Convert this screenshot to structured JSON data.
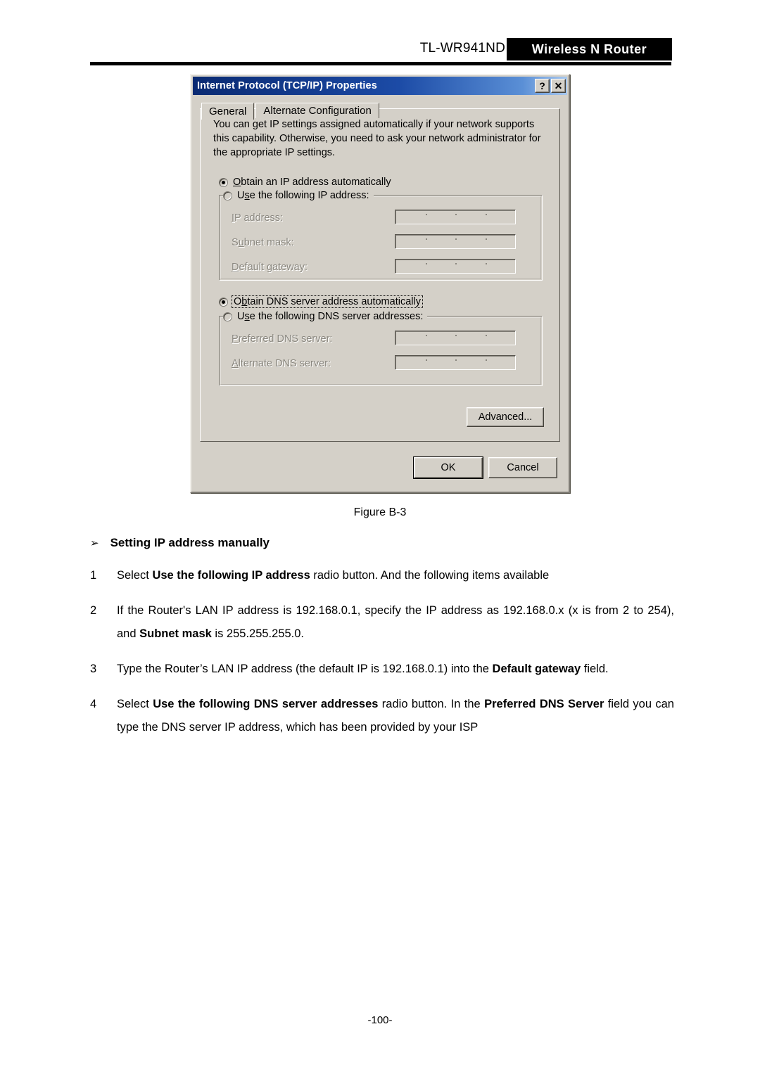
{
  "header": {
    "model": "TL-WR941ND",
    "banner": "Wireless N Router"
  },
  "dialog": {
    "title": "Internet Protocol (TCP/IP) Properties",
    "help_button": "?",
    "close_button": "✕",
    "tabs": [
      {
        "label": "General",
        "active": true
      },
      {
        "label": "Alternate Configuration",
        "active": false
      }
    ],
    "intro": "You can get IP settings assigned automatically if your network supports this capability. Otherwise, you need to ask your network administrator for the appropriate IP settings.",
    "ip_section": {
      "auto_radio": {
        "label": "Obtain an IP address automatically",
        "checked": true
      },
      "manual_radio": {
        "label": "Use the following IP address:",
        "checked": false
      },
      "fields": [
        {
          "label": "IP address:",
          "value": ""
        },
        {
          "label": "Subnet mask:",
          "value": ""
        },
        {
          "label": "Default gateway:",
          "value": ""
        }
      ]
    },
    "dns_section": {
      "auto_radio": {
        "label": "Obtain DNS server address automatically",
        "checked": true,
        "focused": true
      },
      "manual_radio": {
        "label": "Use the following DNS server addresses:",
        "checked": false
      },
      "fields": [
        {
          "label": "Preferred DNS server:",
          "value": ""
        },
        {
          "label": "Alternate DNS server:",
          "value": ""
        }
      ]
    },
    "advanced_button": "Advanced...",
    "ok_button": "OK",
    "cancel_button": "Cancel"
  },
  "document": {
    "figure_caption": "Figure B-3",
    "section_heading": "Setting IP address manually",
    "bullet_glyph": "➢",
    "steps": [
      {
        "num": "1",
        "parts": [
          {
            "t": "Select ",
            "b": false
          },
          {
            "t": "Use the following IP address",
            "b": true
          },
          {
            "t": " radio button. And the following items available",
            "b": false
          }
        ]
      },
      {
        "num": "2",
        "parts": [
          {
            "t": "If the Router's LAN IP address is 192.168.0.1, specify the IP address as 192.168.0.x (x is from 2 to 254), and ",
            "b": false
          },
          {
            "t": "Subnet mask",
            "b": true
          },
          {
            "t": " is 255.255.255.0.",
            "b": false
          }
        ]
      },
      {
        "num": "3",
        "parts": [
          {
            "t": "Type the Router’s LAN IP address (the default IP is 192.168.0.1) into the ",
            "b": false
          },
          {
            "t": "Default gateway",
            "b": true
          },
          {
            "t": " field.",
            "b": false
          }
        ]
      },
      {
        "num": "4",
        "parts": [
          {
            "t": "Select ",
            "b": false
          },
          {
            "t": "Use the following DNS server addresses",
            "b": true
          },
          {
            "t": " radio button. In the ",
            "b": false
          },
          {
            "t": "Preferred DNS Server",
            "b": true
          },
          {
            "t": " field you can type the DNS server IP address, which has been provided by your ISP",
            "b": false
          }
        ]
      }
    ],
    "page_number": "-100-"
  },
  "colors": {
    "dialog_face": "#d4d0c8",
    "titlebar_start": "#0a2a72",
    "banner_bg": "#000000",
    "disabled_text": "#8a877f"
  }
}
